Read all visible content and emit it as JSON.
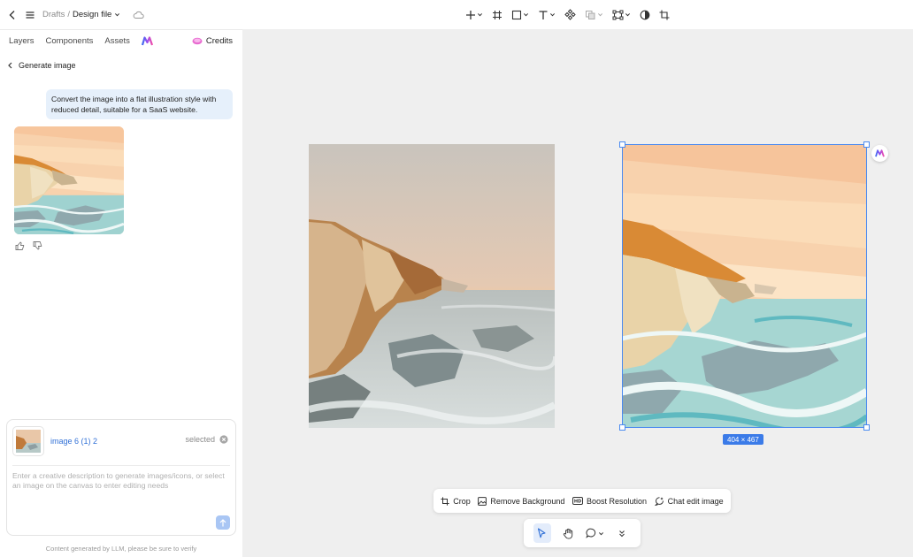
{
  "topbar": {
    "crumb_parent": "Drafts",
    "crumb_separator": "/",
    "crumb_file": "Design file"
  },
  "sidebar": {
    "tabs": [
      "Layers",
      "Components",
      "Assets"
    ],
    "credits_label": "Credits",
    "back_label": "Generate image",
    "user_message": "Convert the image into a flat illustration style with reduced detail, suitable for a SaaS website."
  },
  "input": {
    "attachment_name": "image 6 (1) 2",
    "attachment_status": "selected",
    "placeholder": "Enter a creative description to generate images/icons, or select an image on the canvas to enter editing needs",
    "disclaimer": "Content generated by LLM, please be sure to verify"
  },
  "canvas": {
    "selection_size": "404 × 467"
  },
  "actions": {
    "crop": "Crop",
    "remove_bg": "Remove Background",
    "boost": "Boost Resolution",
    "chat_edit": "Chat edit image"
  },
  "colors": {
    "accent": "#4a8af0",
    "bubble": "#e6f0fb",
    "link": "#2f6fd6"
  }
}
